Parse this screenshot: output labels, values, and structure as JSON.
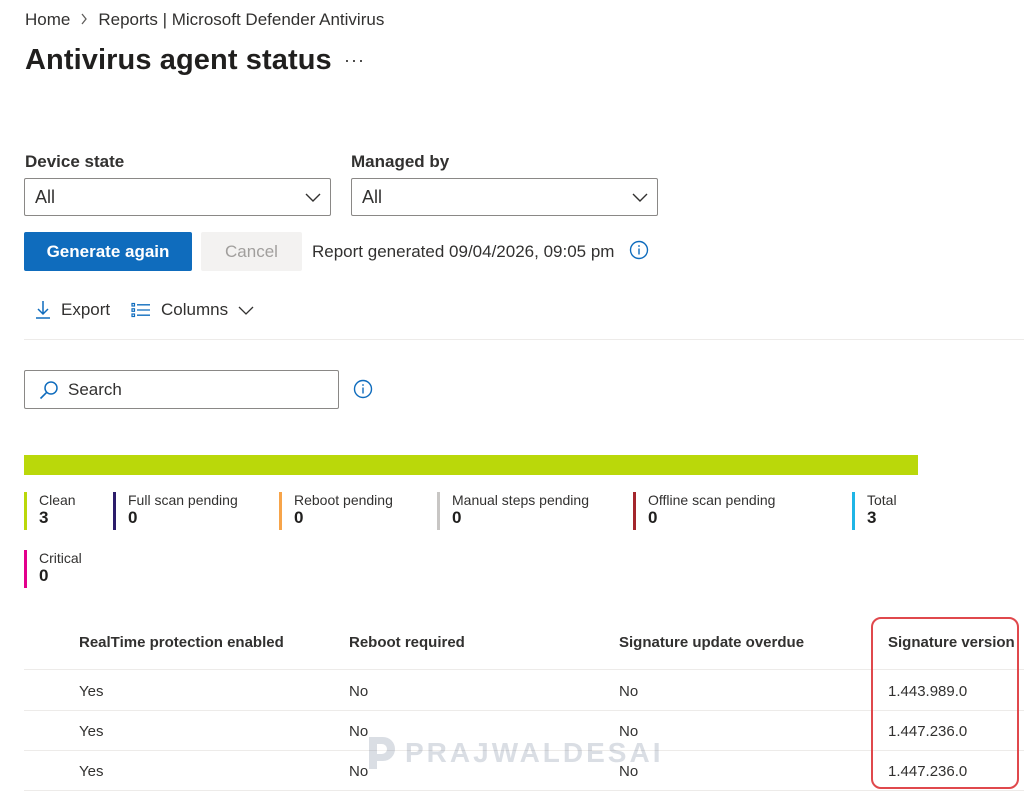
{
  "breadcrumb": {
    "home": "Home",
    "current": "Reports | Microsoft Defender Antivirus"
  },
  "page": {
    "title": "Antivirus agent status",
    "more": "···"
  },
  "filters": {
    "device_state": {
      "label": "Device state",
      "value": "All"
    },
    "managed_by": {
      "label": "Managed by",
      "value": "All"
    }
  },
  "actions": {
    "generate": "Generate again",
    "cancel": "Cancel",
    "report_generated": "Report generated 09/04/2026, 09:05 pm"
  },
  "toolbar": {
    "export": "Export",
    "columns": "Columns"
  },
  "search": {
    "placeholder": "Search"
  },
  "status_bar": {
    "color": "#bad80a",
    "clean_fraction": 1.0
  },
  "legend": [
    {
      "label": "Clean",
      "value": "3",
      "color": "#bad80a"
    },
    {
      "label": "Full scan pending",
      "value": "0",
      "color": "#2c1d6b"
    },
    {
      "label": "Reboot pending",
      "value": "0",
      "color": "#f7a44a"
    },
    {
      "label": "Manual steps pending",
      "value": "0",
      "color": "#c8c6c4"
    },
    {
      "label": "Offline scan pending",
      "value": "0",
      "color": "#a4262c"
    },
    {
      "label": "Total",
      "value": "3",
      "color": "#1fb5e6"
    },
    {
      "label": "Critical",
      "value": "0",
      "color": "#e3008c"
    }
  ],
  "table": {
    "columns": [
      "RealTime protection enabled",
      "Reboot required",
      "Signature update overdue",
      "Signature version"
    ],
    "rows": [
      [
        "Yes",
        "No",
        "No",
        "1.443.989.0"
      ],
      [
        "Yes",
        "No",
        "No",
        "1.447.236.0"
      ],
      [
        "Yes",
        "No",
        "No",
        "1.447.236.0"
      ]
    ]
  },
  "watermark": {
    "text": "PRAJWALDESAI"
  },
  "colors": {
    "primary": "#0f6cbd",
    "highlight": "#e0484c",
    "info": "#0f6cbd"
  }
}
